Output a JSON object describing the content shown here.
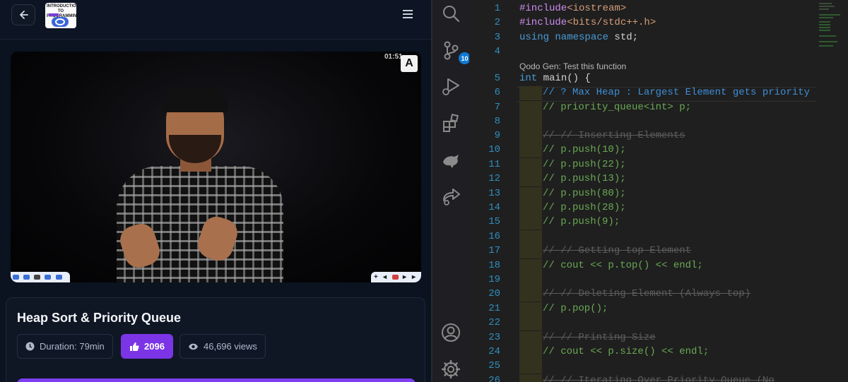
{
  "video_panel": {
    "back_label": "←",
    "logo_text": "INTRODUCTION TO PROGRAMMING",
    "video_badge": "A",
    "video_time": "01:51",
    "card": {
      "title": "Heap Sort & Priority Queue",
      "duration": "Duration: 79min",
      "likes": "2096",
      "views": "46,696 views"
    }
  },
  "activity_bar": {
    "items": [
      "search-icon",
      "source-control-icon",
      "run-debug-icon",
      "extensions-icon",
      "tools-icon",
      "share-icon"
    ],
    "source_control_badge": "10",
    "bottom_items": [
      "account-icon",
      "settings-icon"
    ]
  },
  "editor": {
    "codelens_hint": "Qodo Gen: Test this function",
    "lines": [
      {
        "n": "1",
        "text": "#include<iostream>"
      },
      {
        "n": "2",
        "text": "#include<bits/stdc++.h>"
      },
      {
        "n": "3",
        "text": "using namespace std;"
      },
      {
        "n": "4",
        "text": ""
      },
      {
        "n": "5",
        "text": "int main() {"
      },
      {
        "n": "6",
        "text": "// ? Max Heap : Largest Element gets priority"
      },
      {
        "n": "7",
        "text": "// priority_queue<int> p;"
      },
      {
        "n": "8",
        "text": ""
      },
      {
        "n": "9",
        "text": "// // Inserting Elements"
      },
      {
        "n": "10",
        "text": "// p.push(10);"
      },
      {
        "n": "11",
        "text": "// p.push(22);"
      },
      {
        "n": "12",
        "text": "// p.push(13);"
      },
      {
        "n": "13",
        "text": "// p.push(80);"
      },
      {
        "n": "14",
        "text": "// p.push(28);"
      },
      {
        "n": "15",
        "text": "// p.push(9);"
      },
      {
        "n": "16",
        "text": ""
      },
      {
        "n": "17",
        "text": "// // Getting top Element"
      },
      {
        "n": "18",
        "text": "// cout << p.top() << endl;"
      },
      {
        "n": "19",
        "text": ""
      },
      {
        "n": "20",
        "text": "// // Deleting Element (Always top)"
      },
      {
        "n": "21",
        "text": "// p.pop();"
      },
      {
        "n": "22",
        "text": ""
      },
      {
        "n": "23",
        "text": "// // Printing Size"
      },
      {
        "n": "24",
        "text": "// cout << p.size() << endl;"
      },
      {
        "n": "25",
        "text": ""
      },
      {
        "n": "26",
        "text": "// // Iterating Over Priority Queue (No"
      }
    ]
  },
  "colors": {
    "accent_purple": "#7b35e6",
    "keyword": "#4a9bd8",
    "comment": "#6aaa55",
    "line_number": "#2f8fbf"
  }
}
